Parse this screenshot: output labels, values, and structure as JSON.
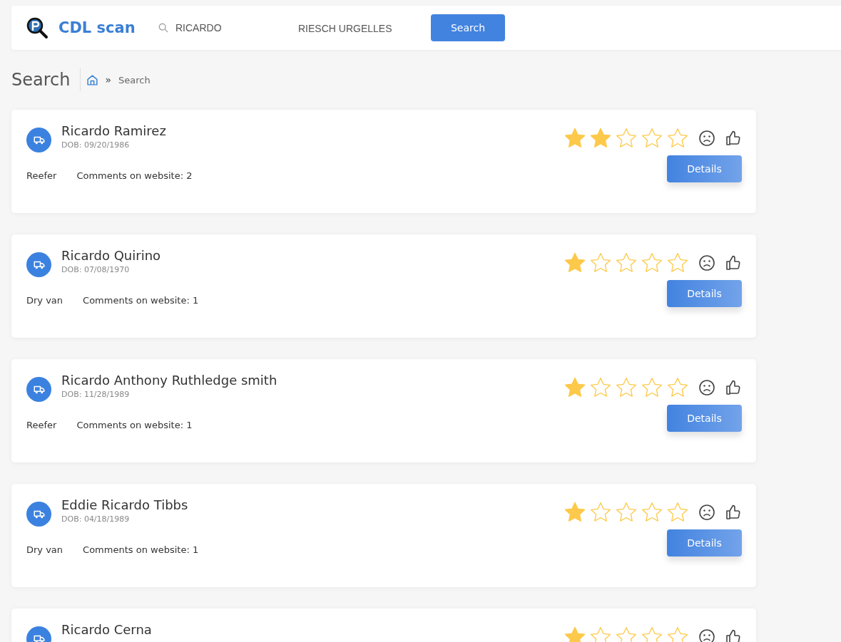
{
  "header": {
    "brand": "CDL scan",
    "search_first": {
      "value": "RICARDO"
    },
    "search_last": {
      "value": "RIESCH URGELLES"
    },
    "search_button": "Search"
  },
  "page": {
    "title": "Search",
    "breadcrumb": [
      {
        "separator": "»",
        "label": "Search"
      }
    ]
  },
  "results": [
    {
      "name": "Ricardo Ramirez",
      "dob": "DOB: 09/20/1986",
      "trailer": "Reefer",
      "comments": "Comments on website: 2",
      "stars": 2,
      "button": "Details"
    },
    {
      "name": "Ricardo Quirino",
      "dob": "DOB: 07/08/1970",
      "trailer": "Dry van",
      "comments": "Comments on website: 1",
      "stars": 1,
      "button": "Details"
    },
    {
      "name": "Ricardo Anthony Ruthledge smith",
      "dob": "DOB: 11/28/1989",
      "trailer": "Reefer",
      "comments": "Comments on website: 1",
      "stars": 1,
      "button": "Details"
    },
    {
      "name": "Eddie Ricardo Tibbs",
      "dob": "DOB: 04/18/1989",
      "trailer": "Dry van",
      "comments": "Comments on website: 1",
      "stars": 1,
      "button": "Details"
    },
    {
      "name": "Ricardo Cerna",
      "stars": 1
    }
  ]
}
